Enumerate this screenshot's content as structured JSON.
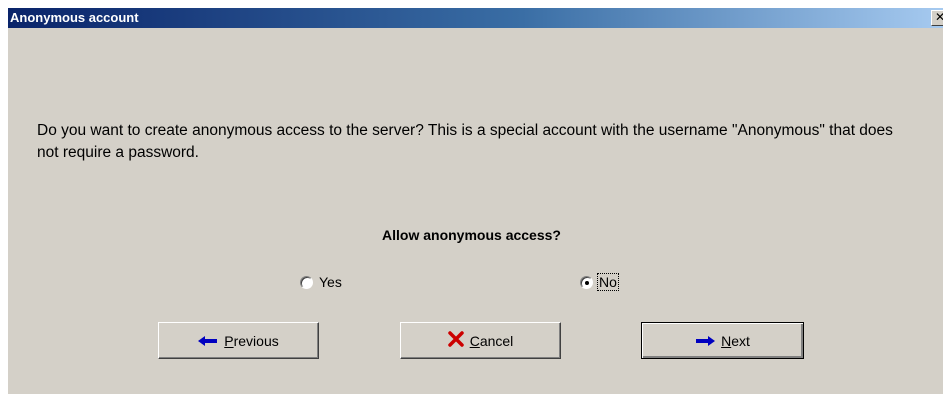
{
  "window": {
    "title": "Anonymous account",
    "close_glyph": "✕"
  },
  "content": {
    "message": "Do you want to create anonymous access to the server? This is a special account with the username \"Anonymous\" that does not require a password.",
    "question": "Allow anonymous access?"
  },
  "options": [
    {
      "label": "Yes",
      "selected": false
    },
    {
      "label": "No",
      "selected": true
    }
  ],
  "buttons": {
    "previous": {
      "mnemonic": "P",
      "rest": "revious",
      "icon": "arrow-left-icon"
    },
    "cancel": {
      "mnemonic": "C",
      "rest": "ancel",
      "icon": "red-x-icon"
    },
    "next": {
      "mnemonic": "N",
      "rest": "ext",
      "icon": "arrow-right-icon"
    }
  },
  "colors": {
    "dialog_bg": "#d4d0c8",
    "title_gradient_start": "#0a246a",
    "arrow_blue": "#0000c0",
    "cancel_red": "#cc0000"
  }
}
